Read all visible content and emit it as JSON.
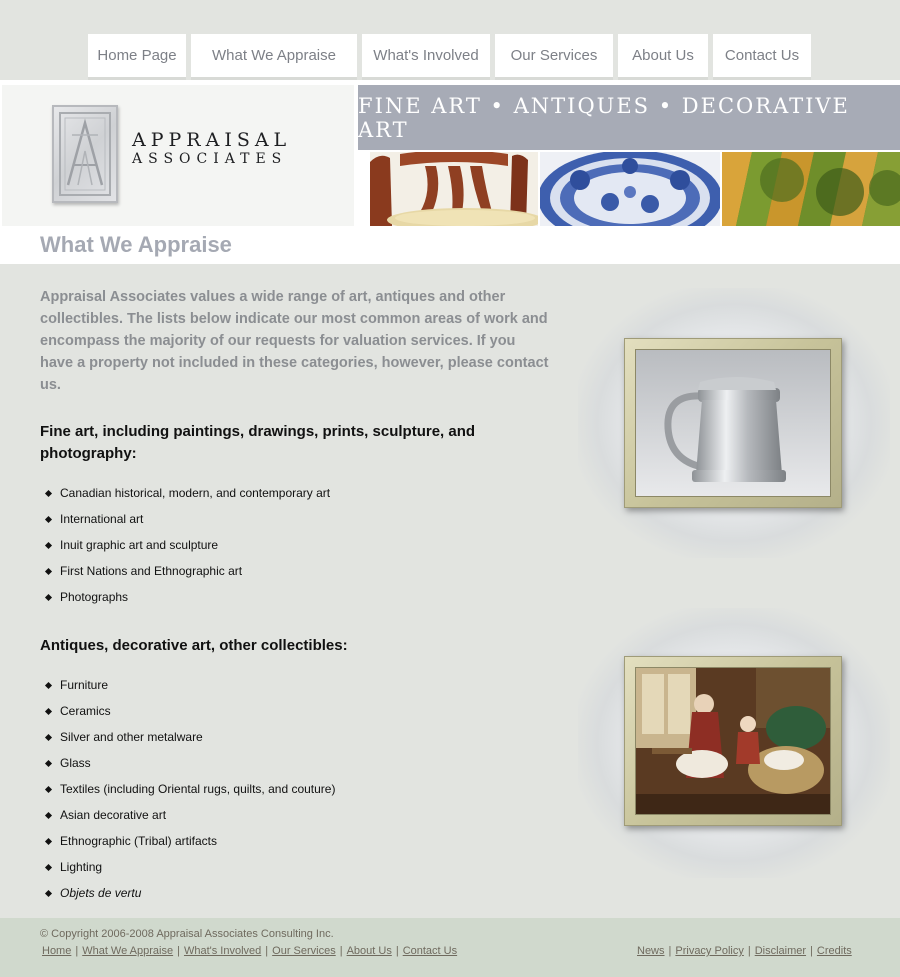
{
  "nav": {
    "items": [
      {
        "label": "Home Page"
      },
      {
        "label": "What We Appraise"
      },
      {
        "label": "What's Involved"
      },
      {
        "label": "Our Services"
      },
      {
        "label": "About Us"
      },
      {
        "label": "Contact Us"
      }
    ]
  },
  "logo": {
    "title": "APPRAISAL",
    "subtitle": "ASSOCIATES"
  },
  "banner": {
    "text": "FINE ART • ANTIQUES • DECORATIVE ART"
  },
  "page": {
    "title": "What We Appraise",
    "intro": "Appraisal Associates values a wide range of art, antiques and other collectibles. The lists below indicate our most common areas of work and encompass the majority of our requests for valuation services. If you have a property not included in these categories, however, please contact us."
  },
  "sections": [
    {
      "heading": "Fine art, including paintings, drawings, prints, sculpture, and photography:",
      "items": [
        "Canadian historical, modern, and contemporary art",
        "International art",
        "Inuit graphic art and sculpture",
        "First Nations and Ethnographic art",
        "Photographs"
      ]
    },
    {
      "heading": "Antiques, decorative art, other collectibles:",
      "items": [
        "Furniture",
        "Ceramics",
        "Silver and other metalware",
        "Glass",
        "Textiles (including Oriental rugs, quilts, and couture)",
        "Asian decorative art",
        "Ethnographic (Tribal) artifacts",
        "Lighting",
        "Objets de vertu"
      ]
    }
  ],
  "footer": {
    "copyright": "© Copyright 2006-2008 Appraisal Associates Consulting Inc.",
    "left_links": [
      "Home",
      "What We Appraise",
      "What's Involved",
      "Our Services",
      "About Us",
      "Contact Us"
    ],
    "right_links": [
      "News",
      "Privacy Policy",
      "Disclaimer",
      "Credits"
    ],
    "separator": "|"
  },
  "colors": {
    "background": "#e2e4e0",
    "banner": "#a7abb6",
    "title": "#a5a9b3",
    "footer": "#d0d9cd"
  }
}
